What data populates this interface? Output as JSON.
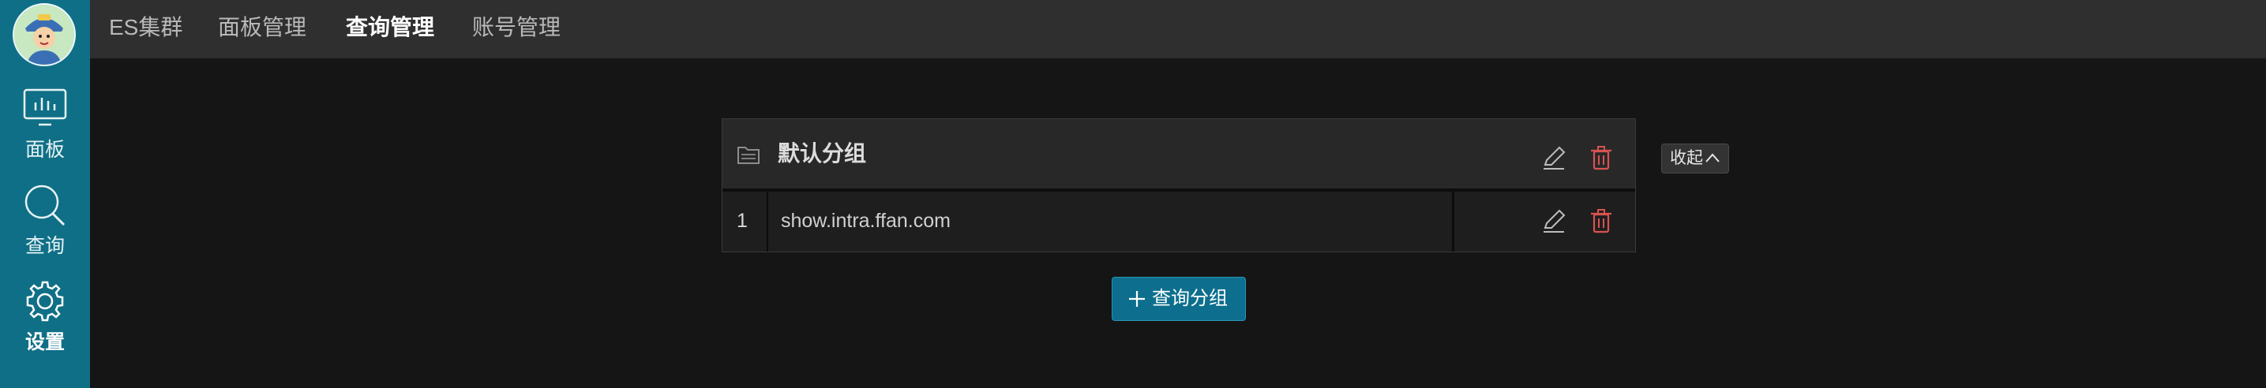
{
  "sidebar": {
    "items": [
      {
        "label": "面板",
        "icon": "dashboard-chart-icon"
      },
      {
        "label": "查询",
        "icon": "search-icon"
      },
      {
        "label": "设置",
        "icon": "gear-icon"
      }
    ],
    "active": "设置"
  },
  "nav": {
    "tabs": [
      {
        "label": "ES集群"
      },
      {
        "label": "面板管理"
      },
      {
        "label": "查询管理"
      },
      {
        "label": "账号管理"
      }
    ],
    "active": "查询管理"
  },
  "group": {
    "title": "默认分组",
    "rows": [
      {
        "index": "1",
        "host": "show.intra.ffan.com"
      }
    ]
  },
  "collapse_button": {
    "label": "收起"
  },
  "add_group_button": {
    "label": "查询分组"
  },
  "colors": {
    "sidebar": "#0f6f86",
    "topbar": "#2f2f2f",
    "background": "#151515",
    "delete": "#d9534f",
    "primary_button": "#0d6f8d"
  }
}
